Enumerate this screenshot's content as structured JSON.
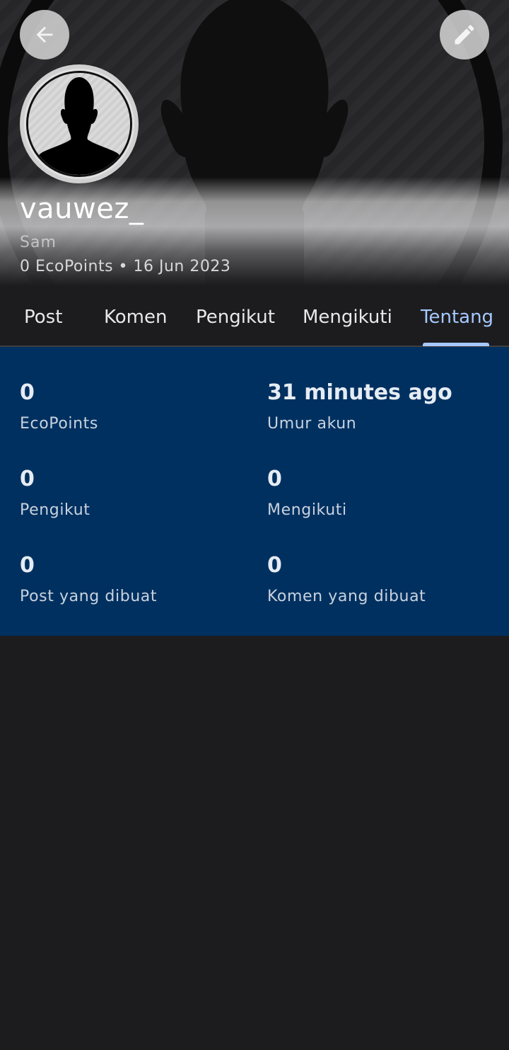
{
  "profile": {
    "username": "vauwez_",
    "realname": "Sam",
    "meta": "0 EcoPoints • 16 Jun 2023"
  },
  "tabs": [
    {
      "label": "Post"
    },
    {
      "label": "Komen"
    },
    {
      "label": "Pengikut"
    },
    {
      "label": "Mengikuti"
    },
    {
      "label": "Tentang",
      "active": true
    }
  ],
  "stats": [
    {
      "value": "0",
      "label": "EcoPoints"
    },
    {
      "value": "31 minutes ago",
      "label": "Umur akun"
    },
    {
      "value": "0",
      "label": "Pengikut"
    },
    {
      "value": "0",
      "label": "Mengikuti"
    },
    {
      "value": "0",
      "label": "Post yang dibuat"
    },
    {
      "value": "0",
      "label": "Komen yang dibuat"
    }
  ],
  "icons": {
    "back": "arrow-left-icon",
    "edit": "pencil-icon",
    "avatar": "person-silhouette-icon"
  },
  "colors": {
    "active_tab": "#a6c8ff",
    "stats_background": "#003060",
    "page_background": "#1c1c1e"
  }
}
